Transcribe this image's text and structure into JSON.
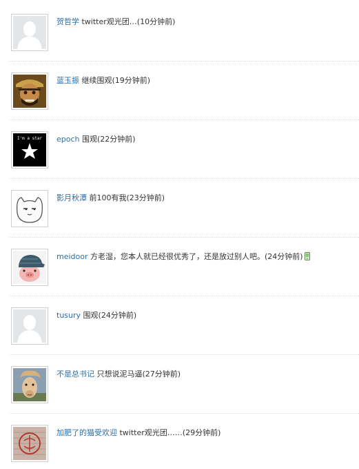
{
  "accent_color": "#2a6fa8",
  "comments": [
    {
      "user": "贺哲学",
      "text": " twitter观光团…",
      "time": "(10分钟前)",
      "avatar": "default-avatar-icon"
    },
    {
      "user": "蓝玉振",
      "text": " 继续围观",
      "time": "(19分钟前)",
      "avatar": "pirate-avatar-icon"
    },
    {
      "user": "epoch",
      "text": " 围观",
      "time": "(22分钟前)",
      "avatar": "star-avatar-icon"
    },
    {
      "user": "影月秋潭",
      "text": " 前100有我",
      "time": "(23分钟前)",
      "avatar": "cat-sketch-avatar-icon"
    },
    {
      "user": "meidoor",
      "text": " 方老湿，您本人就已经很优秀了，还是放过别人吧。",
      "time": "(24分钟前)",
      "avatar": "pig-cap-avatar-icon",
      "via_mobile": true
    },
    {
      "user": "tusury",
      "text": " 围观",
      "time": "(24分钟前)",
      "avatar": "default-avatar-icon"
    },
    {
      "user": "不是总书记",
      "text": " 只想说泥马逼",
      "time": "(27分钟前)",
      "avatar": "alpaca-avatar-icon"
    },
    {
      "user": "加肥了的猫受欢迎",
      "text": " twitter观光团……",
      "time": "(29分钟前)",
      "avatar": "stamp-avatar-icon"
    }
  ],
  "star_text": "I'm a star"
}
